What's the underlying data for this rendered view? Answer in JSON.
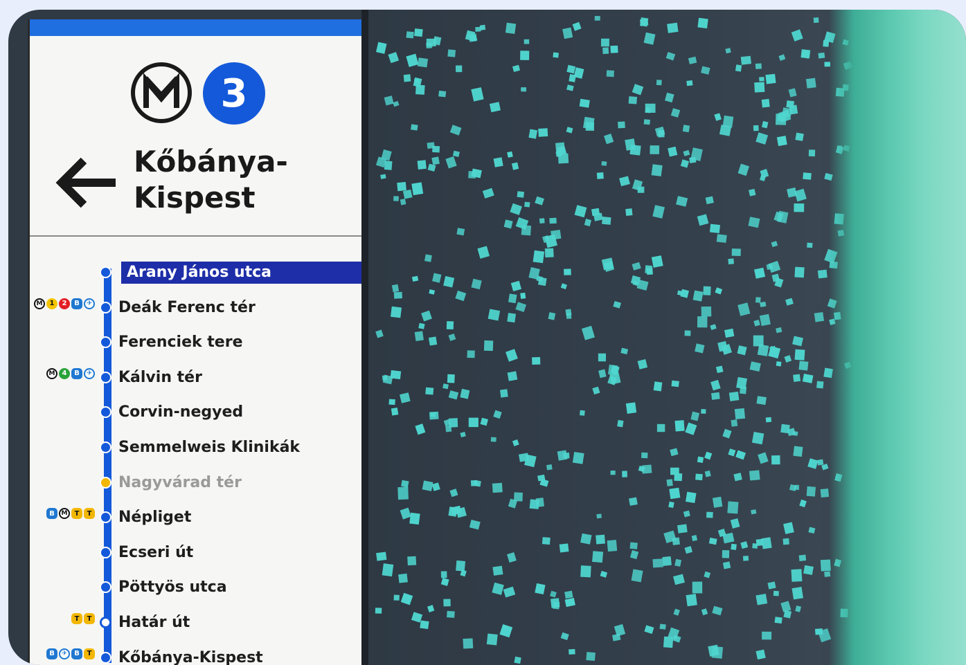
{
  "sign": {
    "line_number": "3",
    "metro_logo_text": "M",
    "direction_arrow": "←",
    "destination_line1": "Kőbánya-",
    "destination_line2": "Kispest"
  },
  "stations": [
    {
      "name": "Arany János utca",
      "current": true,
      "transfers": []
    },
    {
      "name": "Deák Ferenc tér",
      "transfers": [
        "metro",
        "1",
        "2",
        "bus",
        "airport"
      ]
    },
    {
      "name": "Ferenciek tere",
      "transfers": []
    },
    {
      "name": "Kálvin tér",
      "transfers": [
        "metro",
        "4",
        "bus",
        "airport"
      ]
    },
    {
      "name": "Corvin-negyed",
      "transfers": []
    },
    {
      "name": "Semmelweis Klinikák",
      "transfers": []
    },
    {
      "name": "Nagyvárad tér",
      "closed": true,
      "transfers": []
    },
    {
      "name": "Népliget",
      "transfers": [
        "bus",
        "metro",
        "tram",
        "tram"
      ]
    },
    {
      "name": "Ecseri út",
      "transfers": []
    },
    {
      "name": "Pöttyös utca",
      "transfers": []
    },
    {
      "name": "Határ út",
      "terminal_style": true,
      "transfers": [
        "tram",
        "tram"
      ]
    },
    {
      "name": "Kőbánya-Kispest",
      "transfers": [
        "bus",
        "airport",
        "bus",
        "tram"
      ]
    }
  ],
  "colors": {
    "line3_blue": "#1459d9",
    "current_station_bg": "#1e2ea8",
    "wall": "#2f3a45",
    "wall_dots": "#4fd6cf",
    "glass": "#5ed0b5"
  }
}
